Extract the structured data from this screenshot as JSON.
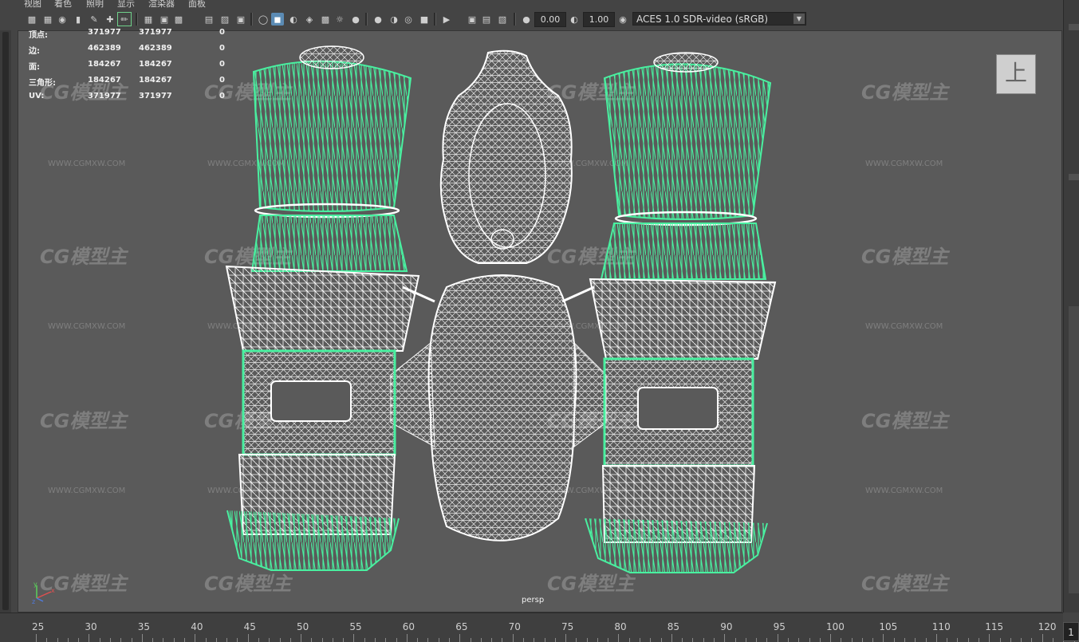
{
  "menu": {
    "items": [
      "视图",
      "着色",
      "照明",
      "显示",
      "渲染器",
      "面板"
    ]
  },
  "toolbar": {
    "gamma_value": "0.00",
    "exposure_value": "1.00",
    "color_space": "ACES 1.0 SDR-video (sRGB)"
  },
  "hud": {
    "rows": [
      {
        "label": "顶点:",
        "v1": "371977",
        "v2": "371977",
        "v3": "0"
      },
      {
        "label": "边:",
        "v1": "462389",
        "v2": "462389",
        "v3": "0"
      },
      {
        "label": "面:",
        "v1": "184267",
        "v2": "184267",
        "v3": "0"
      },
      {
        "label": "三角形:",
        "v1": "184267",
        "v2": "184267",
        "v3": "0"
      },
      {
        "label": "UV:",
        "v1": "371977",
        "v2": "371977",
        "v3": "0"
      }
    ]
  },
  "viewcube": {
    "label": "上"
  },
  "viewport": {
    "camera": "persp"
  },
  "axis": {
    "x": "x",
    "y": "y",
    "z": "z"
  },
  "watermark": {
    "logo": "CG模型主",
    "url": "WWW.CGMXW.COM"
  },
  "timeline": {
    "ticks": [
      "25",
      "30",
      "35",
      "40",
      "45",
      "50",
      "55",
      "60",
      "65",
      "70",
      "75",
      "80",
      "85",
      "90",
      "95",
      "100",
      "105",
      "110",
      "115",
      "120"
    ],
    "current_frame": "1"
  },
  "colors": {
    "viewport_bg": "#5a5a5a",
    "wire_white": "#ffffff",
    "wire_green": "#49f0a0",
    "selection_blue": "#5b8bb4"
  }
}
